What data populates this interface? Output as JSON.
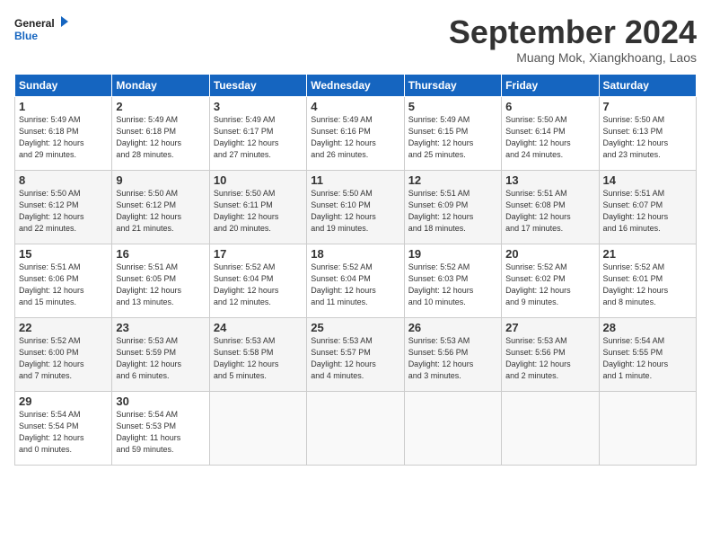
{
  "header": {
    "logo_line1": "General",
    "logo_line2": "Blue",
    "title": "September 2024",
    "location": "Muang Mok, Xiangkhoang, Laos"
  },
  "days_of_week": [
    "Sunday",
    "Monday",
    "Tuesday",
    "Wednesday",
    "Thursday",
    "Friday",
    "Saturday"
  ],
  "weeks": [
    [
      {
        "day": "1",
        "info": "Sunrise: 5:49 AM\nSunset: 6:18 PM\nDaylight: 12 hours\nand 29 minutes."
      },
      {
        "day": "2",
        "info": "Sunrise: 5:49 AM\nSunset: 6:18 PM\nDaylight: 12 hours\nand 28 minutes."
      },
      {
        "day": "3",
        "info": "Sunrise: 5:49 AM\nSunset: 6:17 PM\nDaylight: 12 hours\nand 27 minutes."
      },
      {
        "day": "4",
        "info": "Sunrise: 5:49 AM\nSunset: 6:16 PM\nDaylight: 12 hours\nand 26 minutes."
      },
      {
        "day": "5",
        "info": "Sunrise: 5:49 AM\nSunset: 6:15 PM\nDaylight: 12 hours\nand 25 minutes."
      },
      {
        "day": "6",
        "info": "Sunrise: 5:50 AM\nSunset: 6:14 PM\nDaylight: 12 hours\nand 24 minutes."
      },
      {
        "day": "7",
        "info": "Sunrise: 5:50 AM\nSunset: 6:13 PM\nDaylight: 12 hours\nand 23 minutes."
      }
    ],
    [
      {
        "day": "8",
        "info": "Sunrise: 5:50 AM\nSunset: 6:12 PM\nDaylight: 12 hours\nand 22 minutes."
      },
      {
        "day": "9",
        "info": "Sunrise: 5:50 AM\nSunset: 6:12 PM\nDaylight: 12 hours\nand 21 minutes."
      },
      {
        "day": "10",
        "info": "Sunrise: 5:50 AM\nSunset: 6:11 PM\nDaylight: 12 hours\nand 20 minutes."
      },
      {
        "day": "11",
        "info": "Sunrise: 5:50 AM\nSunset: 6:10 PM\nDaylight: 12 hours\nand 19 minutes."
      },
      {
        "day": "12",
        "info": "Sunrise: 5:51 AM\nSunset: 6:09 PM\nDaylight: 12 hours\nand 18 minutes."
      },
      {
        "day": "13",
        "info": "Sunrise: 5:51 AM\nSunset: 6:08 PM\nDaylight: 12 hours\nand 17 minutes."
      },
      {
        "day": "14",
        "info": "Sunrise: 5:51 AM\nSunset: 6:07 PM\nDaylight: 12 hours\nand 16 minutes."
      }
    ],
    [
      {
        "day": "15",
        "info": "Sunrise: 5:51 AM\nSunset: 6:06 PM\nDaylight: 12 hours\nand 15 minutes."
      },
      {
        "day": "16",
        "info": "Sunrise: 5:51 AM\nSunset: 6:05 PM\nDaylight: 12 hours\nand 13 minutes."
      },
      {
        "day": "17",
        "info": "Sunrise: 5:52 AM\nSunset: 6:04 PM\nDaylight: 12 hours\nand 12 minutes."
      },
      {
        "day": "18",
        "info": "Sunrise: 5:52 AM\nSunset: 6:04 PM\nDaylight: 12 hours\nand 11 minutes."
      },
      {
        "day": "19",
        "info": "Sunrise: 5:52 AM\nSunset: 6:03 PM\nDaylight: 12 hours\nand 10 minutes."
      },
      {
        "day": "20",
        "info": "Sunrise: 5:52 AM\nSunset: 6:02 PM\nDaylight: 12 hours\nand 9 minutes."
      },
      {
        "day": "21",
        "info": "Sunrise: 5:52 AM\nSunset: 6:01 PM\nDaylight: 12 hours\nand 8 minutes."
      }
    ],
    [
      {
        "day": "22",
        "info": "Sunrise: 5:52 AM\nSunset: 6:00 PM\nDaylight: 12 hours\nand 7 minutes."
      },
      {
        "day": "23",
        "info": "Sunrise: 5:53 AM\nSunset: 5:59 PM\nDaylight: 12 hours\nand 6 minutes."
      },
      {
        "day": "24",
        "info": "Sunrise: 5:53 AM\nSunset: 5:58 PM\nDaylight: 12 hours\nand 5 minutes."
      },
      {
        "day": "25",
        "info": "Sunrise: 5:53 AM\nSunset: 5:57 PM\nDaylight: 12 hours\nand 4 minutes."
      },
      {
        "day": "26",
        "info": "Sunrise: 5:53 AM\nSunset: 5:56 PM\nDaylight: 12 hours\nand 3 minutes."
      },
      {
        "day": "27",
        "info": "Sunrise: 5:53 AM\nSunset: 5:56 PM\nDaylight: 12 hours\nand 2 minutes."
      },
      {
        "day": "28",
        "info": "Sunrise: 5:54 AM\nSunset: 5:55 PM\nDaylight: 12 hours\nand 1 minute."
      }
    ],
    [
      {
        "day": "29",
        "info": "Sunrise: 5:54 AM\nSunset: 5:54 PM\nDaylight: 12 hours\nand 0 minutes."
      },
      {
        "day": "30",
        "info": "Sunrise: 5:54 AM\nSunset: 5:53 PM\nDaylight: 11 hours\nand 59 minutes."
      },
      {
        "day": "",
        "info": ""
      },
      {
        "day": "",
        "info": ""
      },
      {
        "day": "",
        "info": ""
      },
      {
        "day": "",
        "info": ""
      },
      {
        "day": "",
        "info": ""
      }
    ]
  ]
}
